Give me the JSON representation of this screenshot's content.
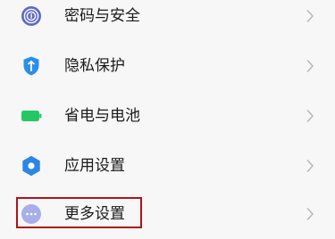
{
  "settings_list": {
    "items": [
      {
        "label": "密码与安全",
        "icon": "fingerprint-icon"
      },
      {
        "label": "隐私保护",
        "icon": "privacy-shield-icon"
      },
      {
        "label": "省电与电池",
        "icon": "battery-icon"
      },
      {
        "label": "应用设置",
        "icon": "gear-icon"
      },
      {
        "label": "更多设置",
        "icon": "more-dots-icon",
        "highlighted": true
      }
    ]
  },
  "colors": {
    "background": "#f7f7f7",
    "text": "#1a1a1a",
    "chevron": "#b9b9b9",
    "fingerprint_icon": "#5b69c7",
    "privacy_icon": "#2a8fe8",
    "battery_icon": "#25c765",
    "gear_icon": "#2b86e6",
    "more_icon": "#a7aee8",
    "highlight_border": "#b1121b"
  }
}
